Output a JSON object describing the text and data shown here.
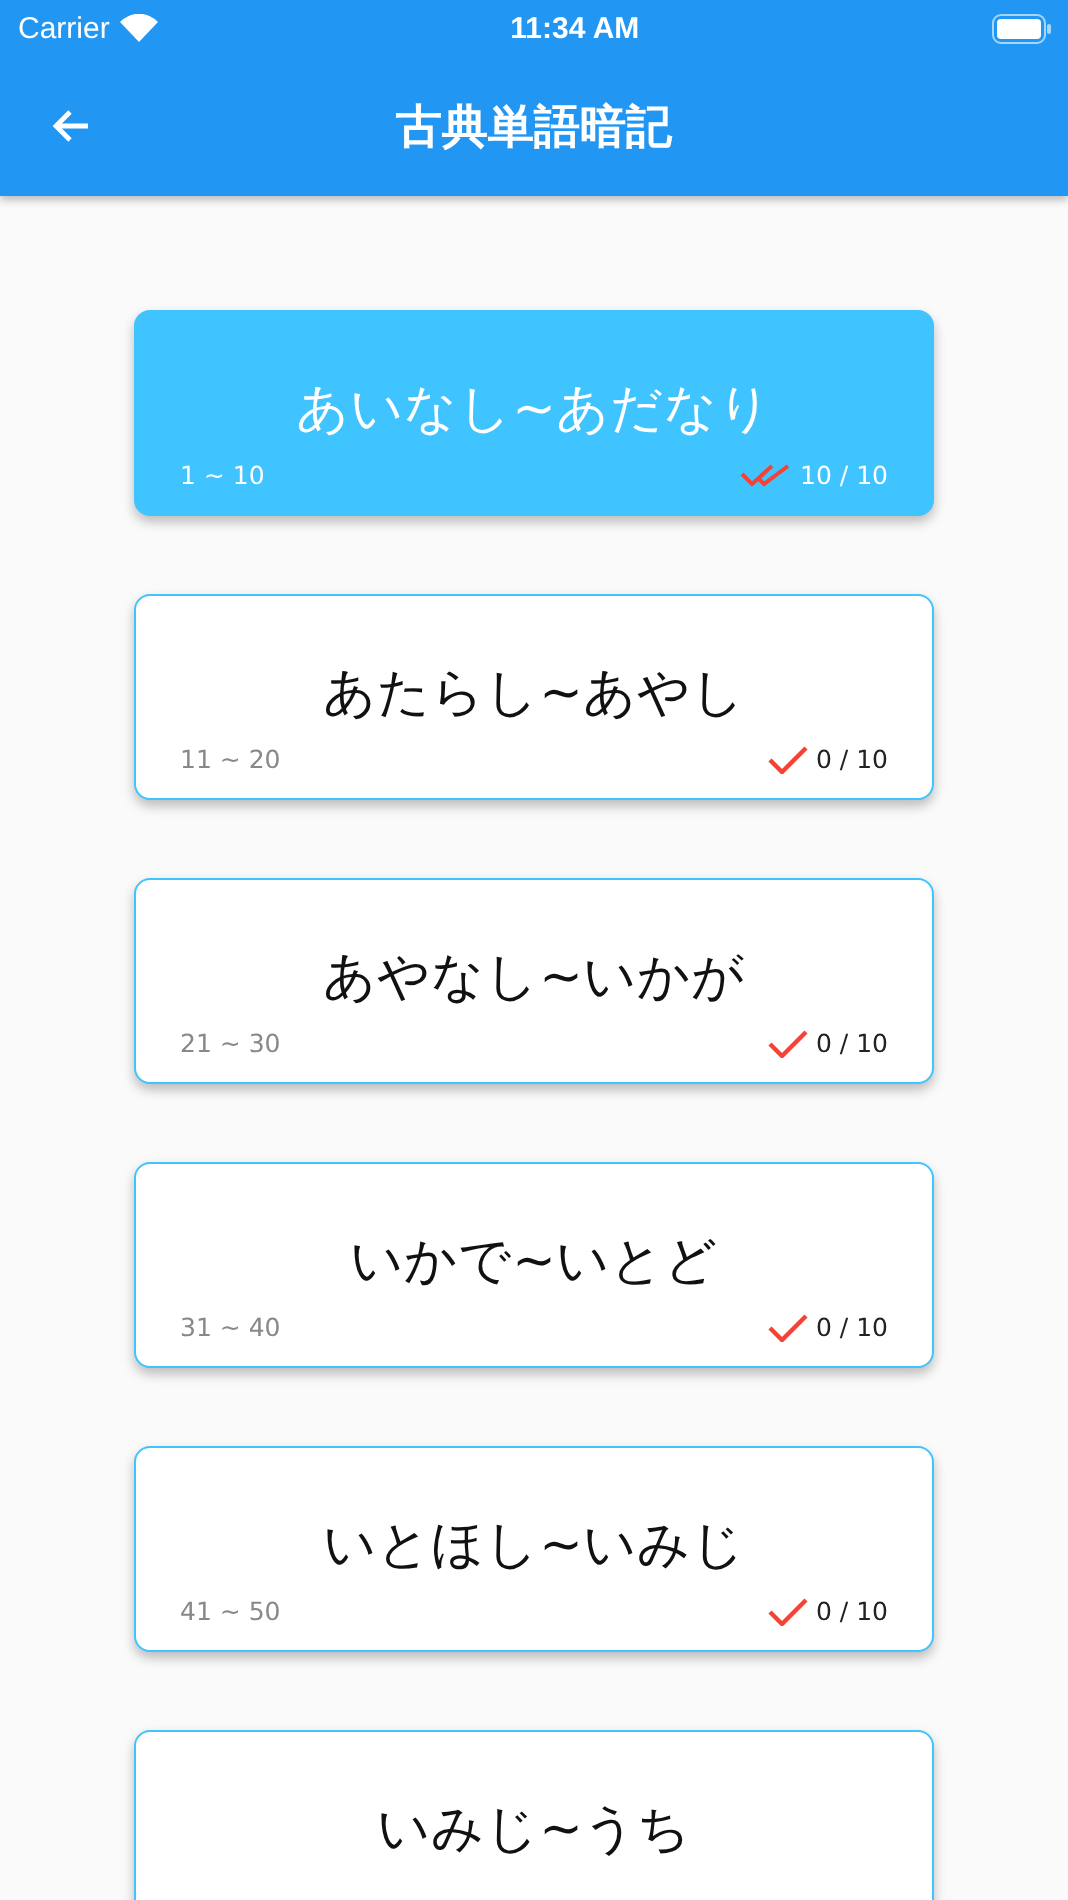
{
  "status_bar": {
    "carrier": "Carrier",
    "time": "11:34 AM"
  },
  "app_bar": {
    "title": "古典単語暗記"
  },
  "cards": [
    {
      "title": "あいなし~あだなり",
      "range": "1 ~ 10",
      "progress": "10 / 10",
      "completed": true
    },
    {
      "title": "あたらし~あやし",
      "range": "11 ~ 20",
      "progress": "0 / 10",
      "completed": false
    },
    {
      "title": "あやなし~いかが",
      "range": "21 ~ 30",
      "progress": "0 / 10",
      "completed": false
    },
    {
      "title": "いかで~いとど",
      "range": "31 ~ 40",
      "progress": "0 / 10",
      "completed": false
    },
    {
      "title": "いとほし~いみじ",
      "range": "41 ~ 50",
      "progress": "0 / 10",
      "completed": false
    },
    {
      "title": "いみじ~うち",
      "completed": false
    }
  ]
}
